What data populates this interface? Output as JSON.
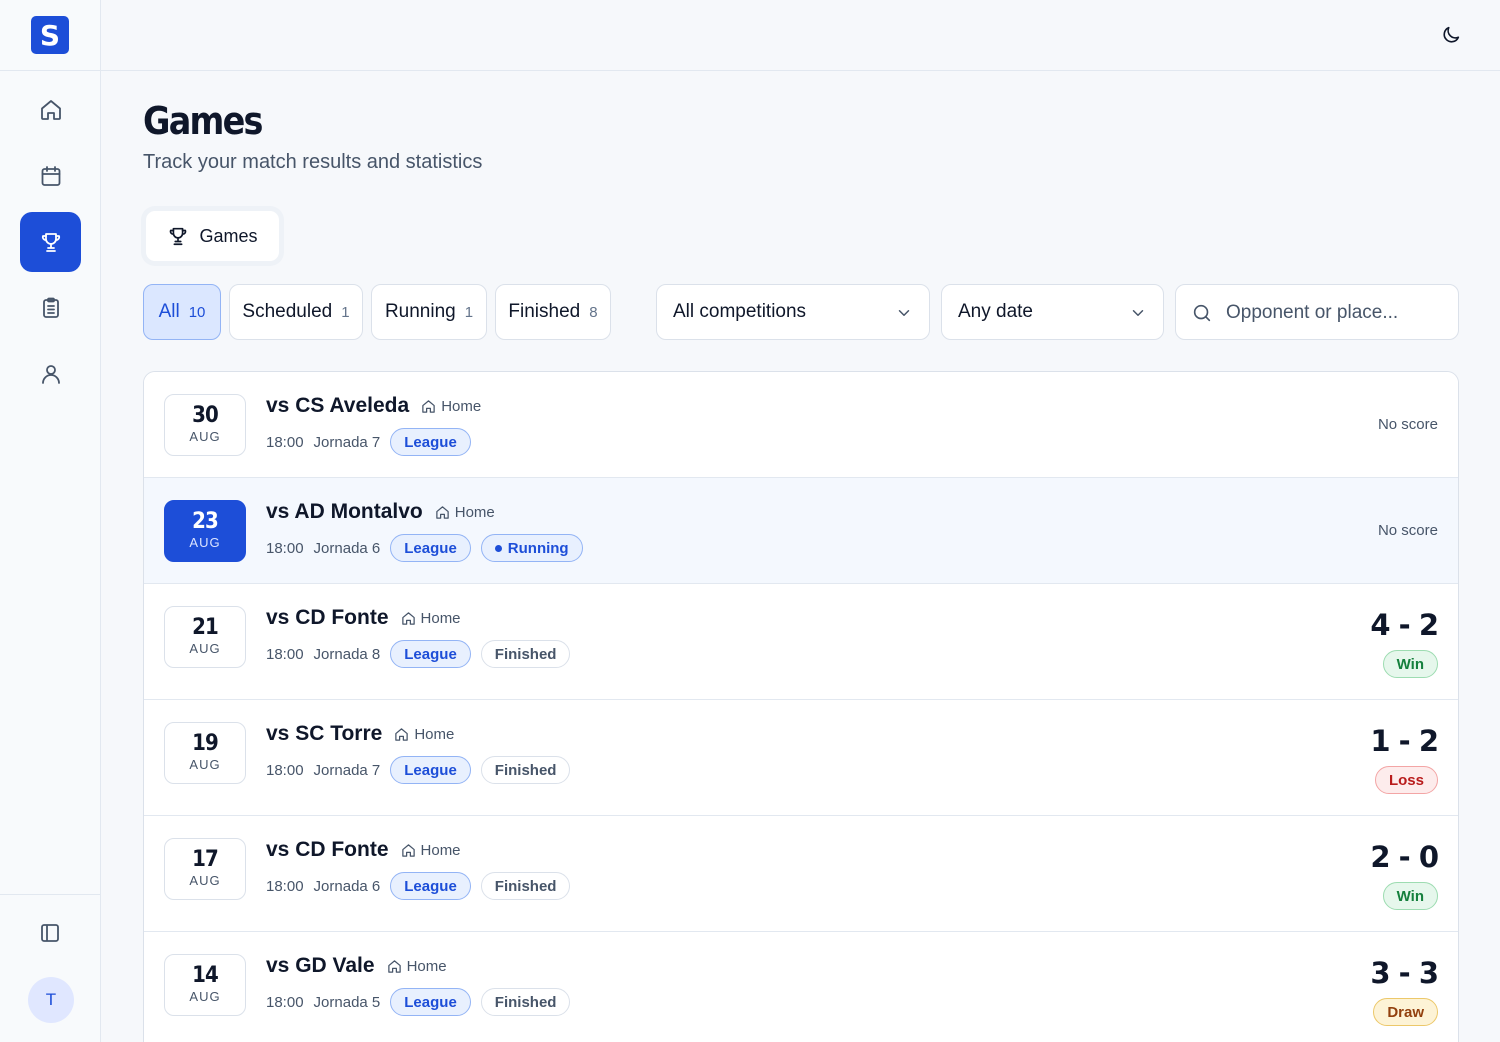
{
  "brand": {
    "logo_letter": "S"
  },
  "sidebar": {
    "items": [
      {
        "name": "home",
        "icon": "home-icon",
        "active": false
      },
      {
        "name": "calendar",
        "icon": "calendar-icon",
        "active": false
      },
      {
        "name": "games",
        "icon": "trophy-icon",
        "active": true
      },
      {
        "name": "tasks",
        "icon": "clipboard-icon",
        "active": false
      },
      {
        "name": "profile",
        "icon": "user-icon",
        "active": false
      }
    ],
    "avatar_initial": "T"
  },
  "header": {
    "title": "Games",
    "subtitle": "Track your match results and statistics"
  },
  "tabs": [
    {
      "label": "Games",
      "icon": "trophy-icon"
    }
  ],
  "filters": {
    "status": [
      {
        "label": "All",
        "count": "10",
        "active": true
      },
      {
        "label": "Scheduled",
        "count": "1",
        "active": false
      },
      {
        "label": "Running",
        "count": "1",
        "active": false
      },
      {
        "label": "Finished",
        "count": "8",
        "active": false
      }
    ],
    "competition": "All competitions",
    "date": "Any date",
    "search_placeholder": "Opponent or place..."
  },
  "games": [
    {
      "day": "30",
      "month": "AUG",
      "opponent": "vs CS Aveleda",
      "venue": "Home",
      "time": "18:00",
      "round": "Jornada 7",
      "competition": "League",
      "status": "scheduled",
      "score": "",
      "result": "",
      "no_score_label": "No score"
    },
    {
      "day": "23",
      "month": "AUG",
      "opponent": "vs AD Montalvo",
      "venue": "Home",
      "time": "18:00",
      "round": "Jornada 6",
      "competition": "League",
      "status": "running",
      "status_label": "Running",
      "score": "",
      "result": "",
      "no_score_label": "No score"
    },
    {
      "day": "21",
      "month": "AUG",
      "opponent": "vs CD Fonte",
      "venue": "Home",
      "time": "18:00",
      "round": "Jornada 8",
      "competition": "League",
      "status": "finished",
      "status_label": "Finished",
      "score": "4 - 2",
      "result": "Win"
    },
    {
      "day": "19",
      "month": "AUG",
      "opponent": "vs SC Torre",
      "venue": "Home",
      "time": "18:00",
      "round": "Jornada 7",
      "competition": "League",
      "status": "finished",
      "status_label": "Finished",
      "score": "1 - 2",
      "result": "Loss"
    },
    {
      "day": "17",
      "month": "AUG",
      "opponent": "vs CD Fonte",
      "venue": "Home",
      "time": "18:00",
      "round": "Jornada 6",
      "competition": "League",
      "status": "finished",
      "status_label": "Finished",
      "score": "2 - 0",
      "result": "Win"
    },
    {
      "day": "14",
      "month": "AUG",
      "opponent": "vs GD Vale",
      "venue": "Home",
      "time": "18:00",
      "round": "Jornada 5",
      "competition": "League",
      "status": "finished",
      "status_label": "Finished",
      "score": "3 - 3",
      "result": "Draw"
    }
  ],
  "colors": {
    "accent": "#1d4ed8",
    "win": "#15803d",
    "loss": "#b91c1c",
    "draw": "#92400e"
  }
}
